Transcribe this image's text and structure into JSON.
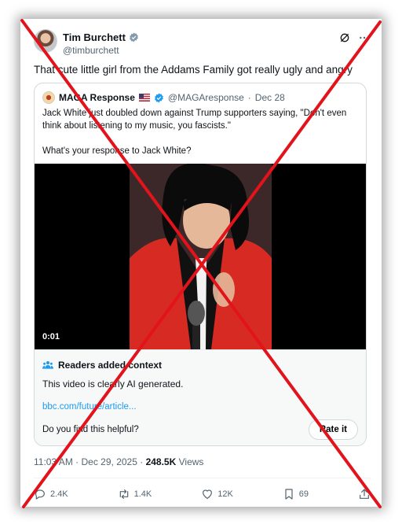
{
  "tweet": {
    "display_name": "Tim Burchett",
    "handle": "@timburchett",
    "text": "That cute little girl from the Addams Family got really ugly and angry",
    "time": "11:03 AM",
    "date": "Dec 29, 2025",
    "separator": "·",
    "views_count": "248.5K",
    "views_label": "Views"
  },
  "quote": {
    "display_name": "MAGA Response",
    "handle": "@MAGAresponse",
    "separator": "·",
    "date": "Dec 28",
    "text_line1": "Jack White just doubled down against Trump supporters saying, \"Don't even think about listening to my music, you fascists.\"",
    "text_line2": "What's your response to Jack White?",
    "video_time": "0:01"
  },
  "community_note": {
    "title": "Readers added context",
    "body": "This video is clearly AI generated.",
    "link": "bbc.com/future/article...",
    "question": "Do you find this helpful?",
    "rate_button": "Rate it"
  },
  "actions": {
    "replies": "2.4K",
    "reposts": "1.4K",
    "likes": "12K",
    "bookmarks": "69"
  },
  "icons": [
    "verified-badge-icon",
    "grok-icon",
    "more-icon",
    "us-flag-icon",
    "people-icon",
    "reply-icon",
    "repost-icon",
    "like-icon",
    "bookmark-icon",
    "share-icon"
  ],
  "colors": {
    "accent": "#1d9bf0",
    "cross": "#e3131b",
    "text": "#0f1419",
    "muted": "#536471",
    "suit_red": "#d62a22"
  }
}
